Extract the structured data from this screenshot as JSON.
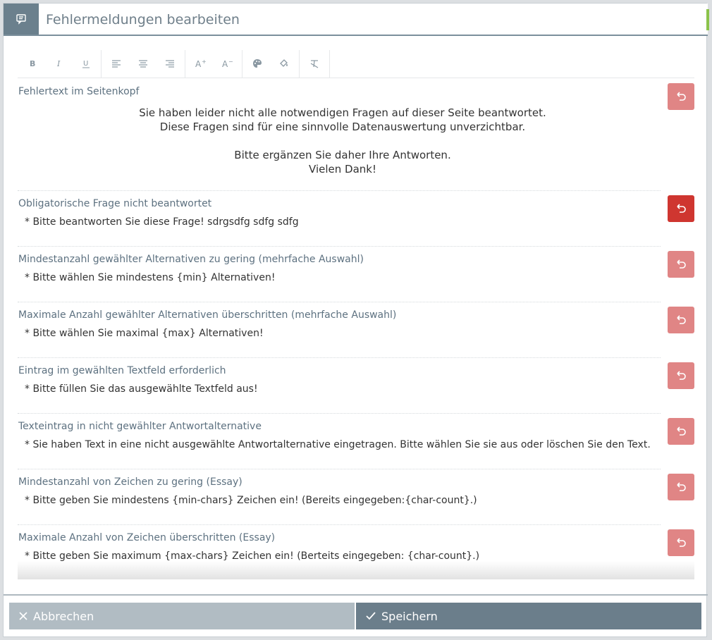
{
  "header": {
    "title": "Fehlermeldungen bearbeiten",
    "icon": "message-icon"
  },
  "toolbar": {
    "groups": [
      [
        "bold-icon",
        "italic-icon",
        "underline-icon"
      ],
      [
        "align-left-icon",
        "align-center-icon",
        "align-right-icon"
      ],
      [
        "font-size-increase-icon",
        "font-size-decrease-icon"
      ],
      [
        "palette-icon",
        "fill-color-icon"
      ],
      [
        "clear-format-icon"
      ]
    ]
  },
  "sections": [
    {
      "label": "Fehlertext im Seitenkopf",
      "lines": [
        "Sie haben leider nicht alle notwendigen Fragen auf dieser Seite beantwortet.",
        "Diese Fragen sind für eine sinnvolle Datenauswertung unverzichtbar.",
        "",
        "Bitte ergänzen Sie daher Ihre Antworten.",
        "Vielen Dank!"
      ]
    },
    {
      "label": "Obligatorische Frage nicht beantwortet",
      "text": "* Bitte beantworten Sie diese Frage! sdrgsdfg sdfg sdfg"
    },
    {
      "label": "Mindestanzahl gewählter Alternativen zu gering (mehrfache Auswahl)",
      "text": "* Bitte wählen Sie mindestens {min} Alternativen!"
    },
    {
      "label": "Maximale Anzahl gewählter Alternativen überschritten (mehrfache Auswahl)",
      "text": "* Bitte wählen Sie maximal {max} Alternativen!"
    },
    {
      "label": "Eintrag im gewählten Textfeld erforderlich",
      "text": "* Bitte füllen Sie das ausgewählte Textfeld aus!"
    },
    {
      "label": "Texteintrag in nicht gewählter Antwortalternative",
      "text": "* Sie haben Text in eine nicht ausgewählte Antwortalternative eingetragen. Bitte wählen Sie sie aus oder löschen Sie den Text."
    },
    {
      "label": "Mindestanzahl von Zeichen zu gering (Essay)",
      "text": "* Bitte geben Sie mindestens {min-chars} Zeichen ein! (Bereits eingegeben:{char-count}.)"
    },
    {
      "label": "Maximale Anzahl von Zeichen überschritten (Essay)",
      "text": "* Bitte geben Sie maximum {max-chars} Zeichen ein! (Berteits eingegeben: {char-count}.)"
    }
  ],
  "colors": {
    "reset": "#e08585",
    "reset_active": "#cf3630",
    "header_icon_bg": "#6b808d"
  },
  "footer": {
    "cancel_label": "Abbrechen",
    "save_label": "Speichern"
  }
}
